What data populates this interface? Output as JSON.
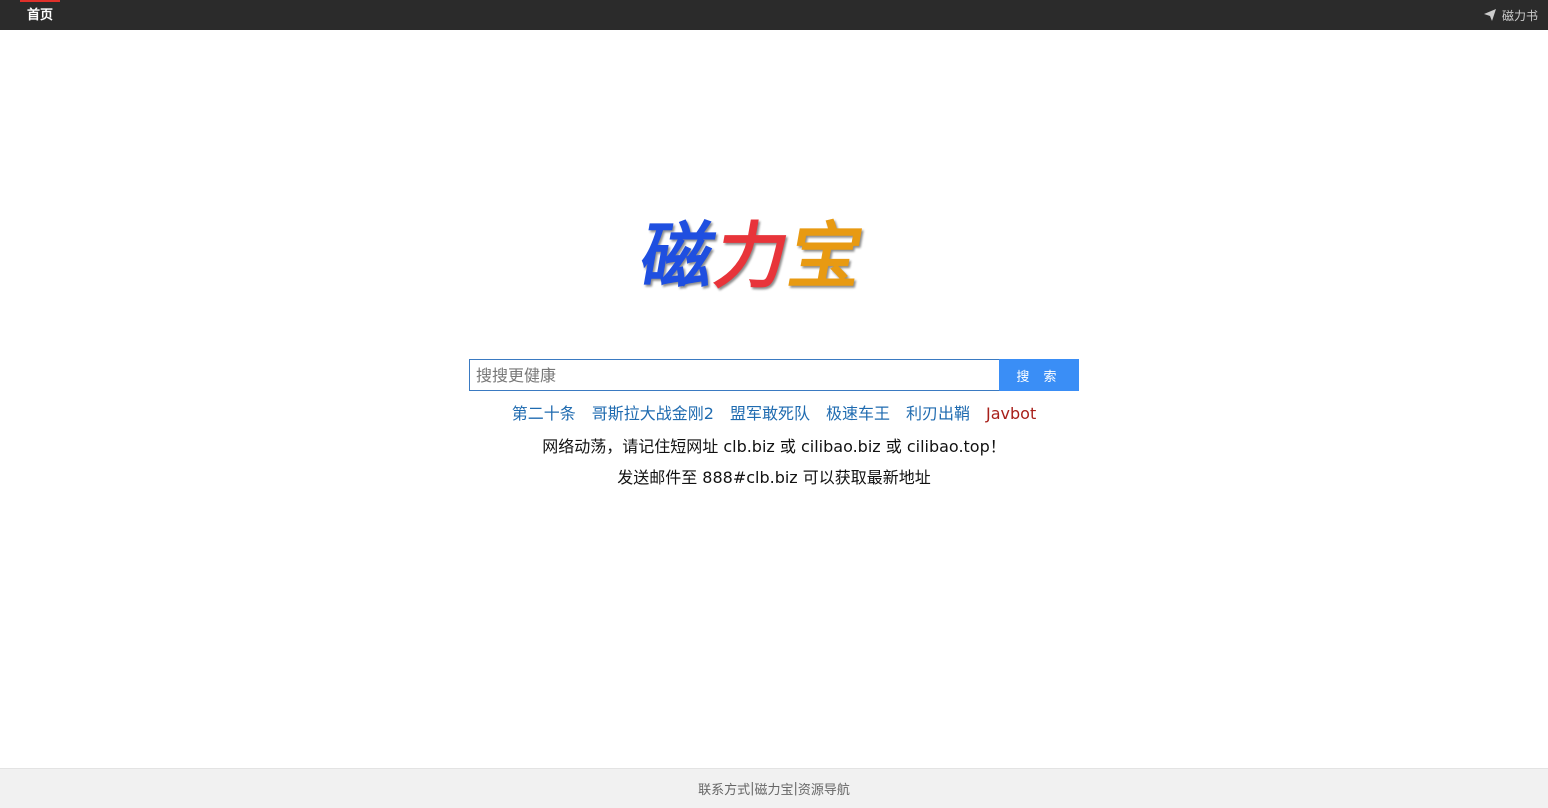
{
  "nav": {
    "home_label": "首页",
    "right_link_label": "磁力书",
    "right_link_icon": "send-icon"
  },
  "logo": {
    "chars": [
      "磁",
      "力",
      "宝"
    ],
    "colors": [
      "#1f4fe0",
      "#e8343a",
      "#e89a12"
    ]
  },
  "search": {
    "placeholder": "搜搜更健康",
    "value": "",
    "button_label": "搜 索"
  },
  "hot_links": [
    {
      "label": "第二十条"
    },
    {
      "label": "哥斯拉大战金刚2"
    },
    {
      "label": "盟军敢死队"
    },
    {
      "label": "极速车王"
    },
    {
      "label": "利刃出鞘"
    },
    {
      "label": "Javbot"
    }
  ],
  "notices": {
    "line1": "网络动荡，请记住短网址 clb.biz 或 cilibao.biz 或 cilibao.top！",
    "line2": "发送邮件至 888#clb.biz 可以获取最新地址"
  },
  "footer": {
    "links": [
      "联系方式",
      "磁力宝",
      "资源导航"
    ],
    "separator": "|"
  },
  "colors": {
    "topbar": "#2b2b2b",
    "active_nav_accent": "#e0302a",
    "search_button": "#3a8ef6",
    "link": "#1f6bb0",
    "special_link": "#a8201a"
  }
}
